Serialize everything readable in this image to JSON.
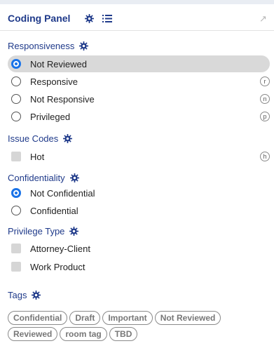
{
  "panel": {
    "title": "Coding Panel"
  },
  "sections": {
    "responsiveness": {
      "title": "Responsiveness",
      "options": [
        {
          "label": "Not Reviewed",
          "shortcut": "",
          "selected": true
        },
        {
          "label": "Responsive",
          "shortcut": "r",
          "selected": false
        },
        {
          "label": "Not Responsive",
          "shortcut": "n",
          "selected": false
        },
        {
          "label": "Privileged",
          "shortcut": "p",
          "selected": false
        }
      ]
    },
    "issue_codes": {
      "title": "Issue Codes",
      "options": [
        {
          "label": "Hot",
          "shortcut": "h",
          "checked": false
        }
      ]
    },
    "confidentiality": {
      "title": "Confidentiality",
      "options": [
        {
          "label": "Not Confidential",
          "selected": true
        },
        {
          "label": "Confidential",
          "selected": false
        }
      ]
    },
    "privilege_type": {
      "title": "Privilege Type",
      "options": [
        {
          "label": "Attorney-Client",
          "checked": false
        },
        {
          "label": "Work Product",
          "checked": false
        }
      ]
    },
    "tags": {
      "title": "Tags",
      "rows": [
        [
          "Confidential",
          "Draft",
          "Important",
          "Not Reviewed"
        ],
        [
          "Reviewed",
          "room tag",
          "TBD"
        ]
      ]
    }
  },
  "colors": {
    "accent": "#1f3a8a",
    "radio_on": "#1a73e8",
    "selected_row": "#d9d9d9"
  }
}
